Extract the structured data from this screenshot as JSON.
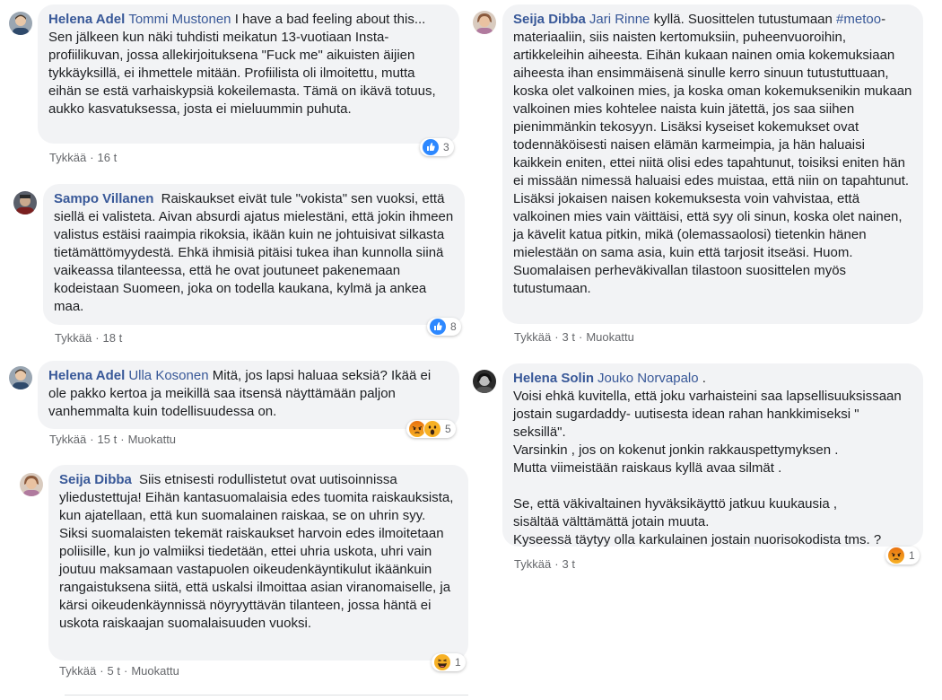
{
  "comments": [
    {
      "author": "Helena Adel",
      "mention": "Tommi Mustonen",
      "text": "I have a bad feeling about this... Sen jälkeen kun näki tuhdisti meikatun 13-vuotiaan Insta-profiilikuvan, jossa allekirjoituksena \"Fuck me\" aikuisten äijien tykkäyksillä, ei ihmettele mitään. Profiilista oli ilmoitettu, mutta eihän se estä varhaiskypsiä kokeilemasta. Tämä on ikävä totuus, aukko kasvatuksessa, josta ei mieluummin puhuta.",
      "reaction_count": "3",
      "reaction_icons": [
        "like-icon"
      ],
      "like_label": "Tykkää",
      "dot": "·",
      "time": "16 t",
      "edited": ""
    },
    {
      "author": "Sampo Villanen",
      "mention": "",
      "text": "Raiskaukset eivät tule \"vokista\" sen vuoksi, että siellä ei valisteta. Aivan absurdi ajatus mielestäni, että jokin ihmeen valistus estäisi raaimpia rikoksia, ikään kuin ne johtuisivat silkasta tietämättömyydestä. Ehkä ihmisiä pitäisi tukea ihan kunnolla siinä vaikeassa tilanteessa, että he ovat joutuneet pakenemaan kodeistaan Suomeen, joka on todella kaukana, kylmä ja ankea maa.",
      "reaction_count": "8",
      "reaction_icons": [
        "like-icon"
      ],
      "like_label": "Tykkää",
      "dot": "·",
      "time": "18 t",
      "edited": ""
    },
    {
      "author": "Helena Adel",
      "mention": "Ulla Kosonen",
      "text": "Mitä, jos lapsi haluaa seksiä? Ikää ei ole pakko kertoa ja meikillä saa itsensä näyttämään paljon vanhemmalta kuin todellisuudessa on.",
      "reaction_count": "5",
      "reaction_icons": [
        "angry-icon",
        "wow-icon"
      ],
      "like_label": "Tykkää",
      "dot": "·",
      "time": "15 t",
      "edited": "Muokattu"
    },
    {
      "author": "Seija Dibba",
      "mention": "",
      "text": "Siis etnisesti rodullistetut ovat uutisoinnissa yliedustettuja! Eihän kantasuomalaisia edes tuomita raiskauksista, kun ajatellaan, että kun suomalainen raiskaa, se on uhrin syy. Siksi suomalaisten tekemät raiskaukset harvoin edes ilmoitetaan poliisille, kun jo valmiiksi tiedetään, ettei uhria uskota, uhri vain joutuu maksamaan vastapuolen oikeudenkäyntikulut ikäänkuin rangaistuksena siitä, että uskalsi ilmoittaa asian viranomaiselle, ja kärsi oikeudenkäynnissä nöyryyttävän tilanteen, jossa häntä ei uskota raiskaajan suomalaisuuden vuoksi.",
      "reaction_count": "1",
      "reaction_icons": [
        "haha-icon"
      ],
      "like_label": "Tykkää",
      "dot": "·",
      "time": "5 t",
      "edited": "Muokattu"
    },
    {
      "author": "Seija Dibba",
      "mention": "Jari Rinne",
      "text_before_tag": "kyllä. Suosittelen tutustumaan ",
      "tag": "#metoo",
      "text": "-materiaaliin, siis naisten kertomuksiin, puheenvuoroihin, artikkeleihin aiheesta. Eihän kukaan nainen omia kokemuksiaan aiheesta ihan ensimmäisenä sinulle kerro sinuun tutustuttuaan, koska olet valkoinen mies, ja koska oman kokemuksenikin mukaan valkoinen mies kohtelee naista kuin jätettä, jos saa siihen pienimmänkin tekosyyn. Lisäksi kyseiset kokemukset ovat todennäköisesti naisen elämän karmeimpia, ja hän haluaisi kaikkein eniten, ettei niitä olisi edes tapahtunut, toisiksi eniten hän ei missään nimessä haluaisi edes muistaa, että niin on tapahtunut. Lisäksi jokaisen naisen kokemuksesta voin vahvistaa, että valkoinen mies vain väittäisi, että syy oli sinun, koska olet nainen, ja kävelit katua pitkin, mikä (olemassaolosi) tietenkin hänen mielestään on sama asia, kuin että tarjosit itseäsi. Huom. Suomalaisen perheväkivallan tilastoon suosittelen myös tutustumaan.",
      "reaction_count": "",
      "reaction_icons": [],
      "like_label": "Tykkää",
      "dot": "·",
      "time": "3 t",
      "edited": "Muokattu"
    },
    {
      "author": "Helena Solin",
      "mention": "Jouko Norvapalo",
      "text": ".\nVoisi ehkä kuvitella, että joku varhaisteini saa lapsellisuuksissaan jostain sugardaddy- uutisesta idean rahan hankkimiseksi \" seksillä\".\nVarsinkin , jos on kokenut jonkin rakkauspettymyksen .\nMutta viimeistään raiskaus kyllä avaa silmät .\n\nSe, että väkivaltainen hyväksikäyttö jatkuu kuukausia ,\nsisältää välttämättä jotain muuta.\nKyseessä täytyy olla karkulainen jostain nuorisokodista tms. ?",
      "reaction_count": "1",
      "reaction_icons": [
        "angry-icon"
      ],
      "like_label": "Tykkää",
      "dot": "·",
      "time": "3 t",
      "edited": ""
    }
  ],
  "colors": {
    "link": "#385898",
    "bubble": "#f2f3f5",
    "meta": "#65676b",
    "like_blue": "#2d88ff",
    "angry_orange": "#e9710f",
    "emoji_yellow": "#f7b125"
  }
}
